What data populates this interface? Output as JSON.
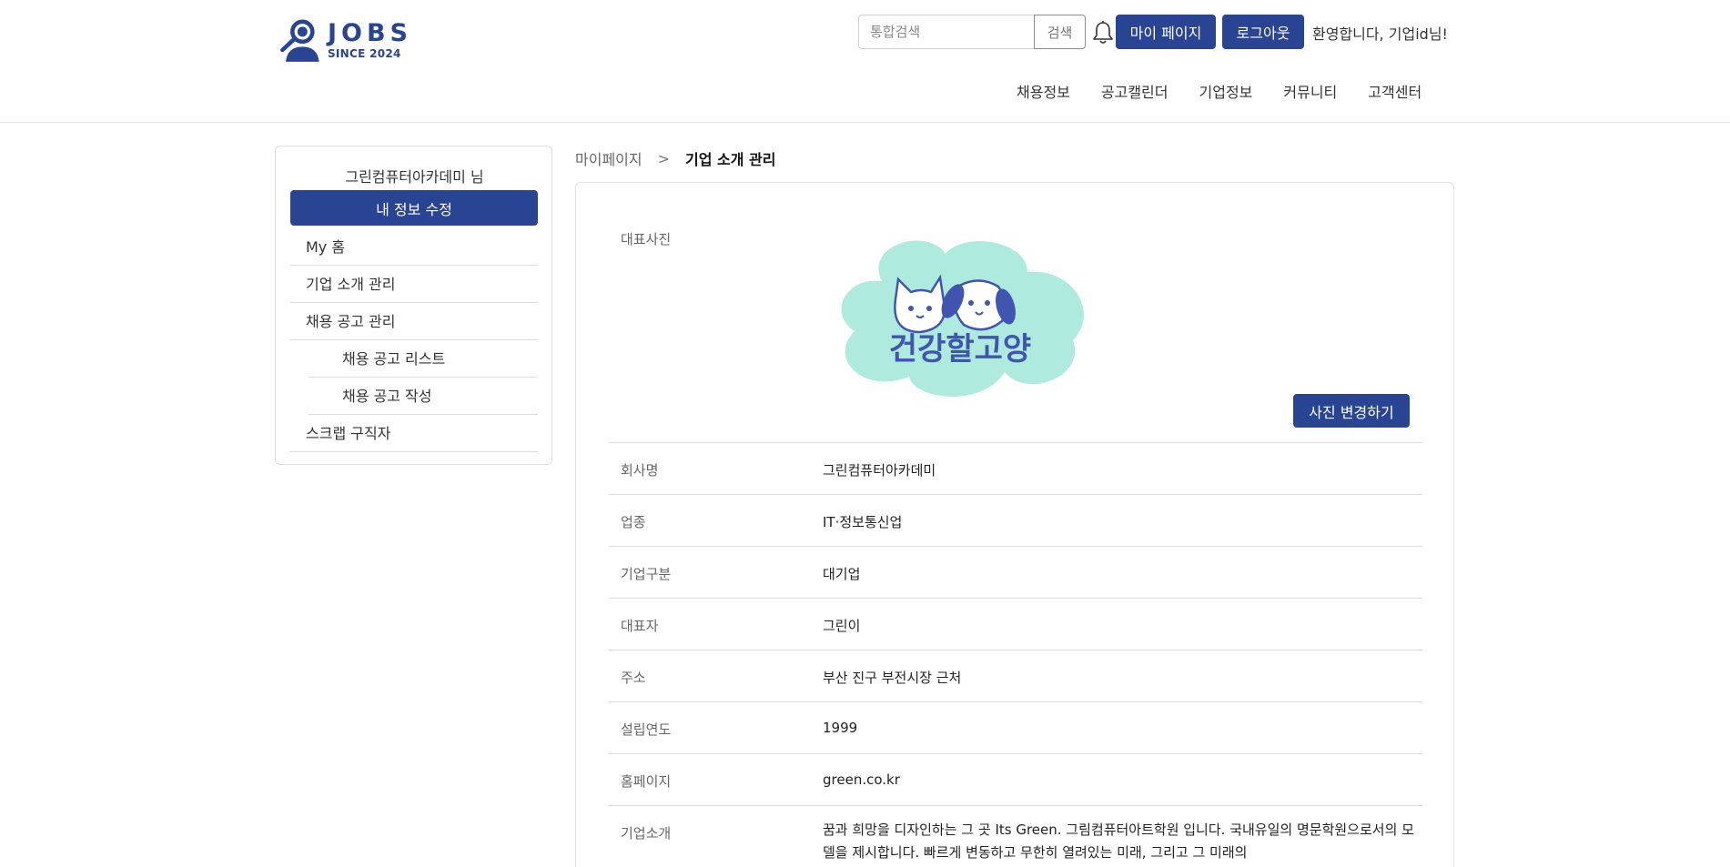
{
  "brand": {
    "logo_word": "JOBS",
    "logo_sub": "SINCE 2024",
    "color": "#2a4494"
  },
  "header": {
    "search_placeholder": "통합검색",
    "search_button": "검색",
    "bell_icon": "bell-icon",
    "mypage_button": "마이 페이지",
    "logout_button": "로그아웃",
    "welcome": "환영합니다, 기업id님!"
  },
  "nav": [
    "채용정보",
    "공고캘린더",
    "기업정보",
    "커뮤니티",
    "고객센터"
  ],
  "sidebar": {
    "title": "그린컴퓨터아카데미 님",
    "edit_button": "내 정보 수정",
    "items": [
      {
        "label": "My 홈"
      },
      {
        "label": "기업 소개 관리"
      },
      {
        "label": "채용 공고 관리"
      },
      {
        "label": "채용 공고 리스트"
      },
      {
        "label": "채용 공고 작성"
      },
      {
        "label": "스크랩 구직자"
      }
    ]
  },
  "breadcrumb": {
    "home": "마이페이지",
    "separator": ">",
    "current": "기업 소개 관리"
  },
  "profile": {
    "photo_label": "대표사진",
    "photo_text": "건강할고양",
    "change_photo_button": "사진 변경하기",
    "fields": [
      {
        "label": "회사명",
        "value": "그린컴퓨터아카데미"
      },
      {
        "label": "업종",
        "value": "IT·정보통신업"
      },
      {
        "label": "기업구분",
        "value": "대기업"
      },
      {
        "label": "대표자",
        "value": "그린이"
      },
      {
        "label": "주소",
        "value": "부산 진구 부전시장 근처"
      },
      {
        "label": "설립연도",
        "value": "1999"
      },
      {
        "label": "홈페이지",
        "value": "green.co.kr"
      },
      {
        "label": "기업소개",
        "value": "꿈과 희망을 디자인하는 그 곳 Its Green. 그림컴퓨터아트학원 입니다. 국내유일의 명문학원으로서의 모델을 제시합니다. 빠르게 변동하고 무한히 열려있는 미래, 그리고 그 미래의"
      }
    ]
  }
}
